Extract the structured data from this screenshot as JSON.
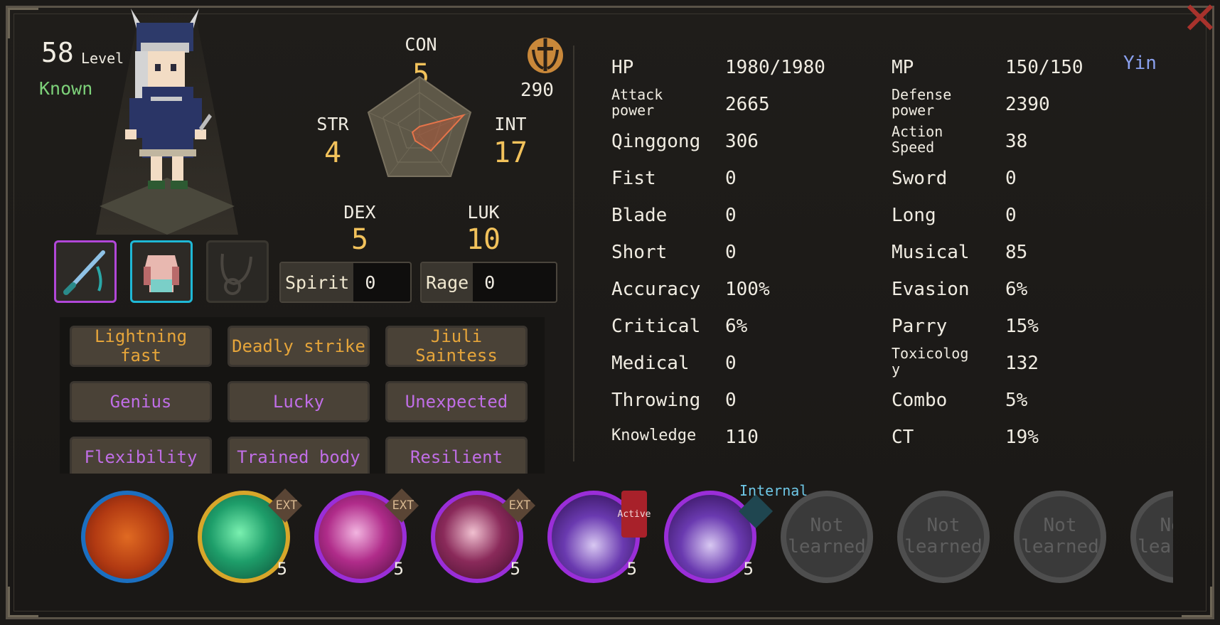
{
  "character": {
    "level": "58",
    "level_label": "Level",
    "status": "Known",
    "potential": "290"
  },
  "attributes": {
    "con": {
      "label": "CON",
      "value": "5"
    },
    "str": {
      "label": "STR",
      "value": "4"
    },
    "int": {
      "label": "INT",
      "value": "17"
    },
    "dex": {
      "label": "DEX",
      "value": "5"
    },
    "luk": {
      "label": "LUK",
      "value": "10"
    }
  },
  "counters": {
    "spirit": {
      "label": "Spirit",
      "value": "0"
    },
    "rage": {
      "label": "Rage",
      "value": "0"
    }
  },
  "traits": [
    {
      "label": "Lightning fast",
      "rarity": "gold"
    },
    {
      "label": "Deadly strike",
      "rarity": "gold"
    },
    {
      "label": "Jiuli Saintess",
      "rarity": "gold"
    },
    {
      "label": "Genius",
      "rarity": "purple"
    },
    {
      "label": "Lucky",
      "rarity": "purple"
    },
    {
      "label": "Unexpected",
      "rarity": "purple"
    },
    {
      "label": "Flexibility",
      "rarity": "purple"
    },
    {
      "label": "Trained body",
      "rarity": "purple"
    },
    {
      "label": "Resilient",
      "rarity": "purple"
    }
  ],
  "stats_left": [
    {
      "name": "HP",
      "value": "1980/1980",
      "small": false
    },
    {
      "name": "Attack power",
      "value": "2665",
      "small": true
    },
    {
      "name": "Qinggong",
      "value": "306",
      "small": false
    },
    {
      "name": "Fist",
      "value": "0",
      "small": false
    },
    {
      "name": "Blade",
      "value": "0",
      "small": false
    },
    {
      "name": "Short",
      "value": "0",
      "small": false
    },
    {
      "name": "Accuracy",
      "value": "100%",
      "small": false
    },
    {
      "name": "Critical",
      "value": "6%",
      "small": false
    },
    {
      "name": "Medical",
      "value": "0",
      "small": false
    },
    {
      "name": "Throwing",
      "value": "0",
      "small": false
    },
    {
      "name": "Knowledge",
      "value": "110",
      "small": false
    }
  ],
  "stats_right": [
    {
      "name": "MP",
      "value": "150/150",
      "small": false
    },
    {
      "name": "Defense power",
      "value": "2390",
      "small": true
    },
    {
      "name": "Action Speed",
      "value": "38",
      "small": true
    },
    {
      "name": "Sword",
      "value": "0",
      "small": false
    },
    {
      "name": "Long",
      "value": "0",
      "small": false
    },
    {
      "name": "Musical",
      "value": "85",
      "small": false
    },
    {
      "name": "Evasion",
      "value": "6%",
      "small": false
    },
    {
      "name": "Parry",
      "value": "15%",
      "small": false
    },
    {
      "name": "Toxicology",
      "value": "132",
      "small": true
    },
    {
      "name": "Combo",
      "value": "5%",
      "small": false
    },
    {
      "name": "CT",
      "value": "19%",
      "small": false
    }
  ],
  "yin": "Yin",
  "skills": [
    {
      "style": "ult",
      "level": "",
      "tag": ""
    },
    {
      "style": "green",
      "level": "5",
      "tag": "EXT"
    },
    {
      "style": "pink",
      "level": "5",
      "tag": "EXT"
    },
    {
      "style": "wine",
      "level": "5",
      "tag": "EXT"
    },
    {
      "style": "violet",
      "level": "5",
      "tag": "Active"
    },
    {
      "style": "violet",
      "level": "5",
      "tag": "Internal"
    },
    {
      "style": "empty",
      "level": "",
      "tag": "Not learned"
    },
    {
      "style": "empty",
      "level": "",
      "tag": "Not learned"
    },
    {
      "style": "empty",
      "level": "",
      "tag": "Not learned"
    },
    {
      "style": "empty",
      "level": "",
      "tag": "Not learned"
    }
  ],
  "colors": {
    "gold": "#e6a53a",
    "purple": "#c06ee6",
    "attr_value": "#f2c25b",
    "status": "#7dd17a",
    "yin": "#8aa0ee"
  }
}
